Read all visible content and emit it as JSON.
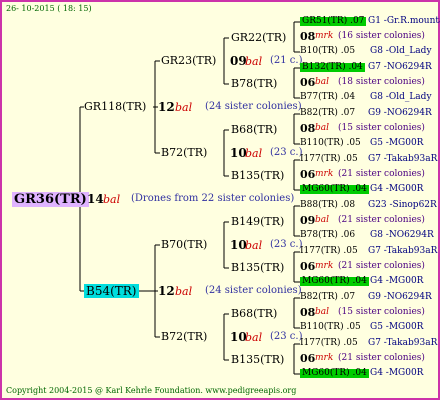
{
  "header": {
    "date": "26- 10-2015 ( 18: 15)"
  },
  "footer": {
    "copyright": "Copyright 2004-2015 @ Karl Kehrle Foundation.   www.pedigreeapis.org"
  },
  "root": {
    "id": "GR36(TR)",
    "year": "14",
    "mark": "bal",
    "note": "(Drones from 22 sister colonies)"
  },
  "gen1": {
    "top": {
      "id": "GR118(TR)",
      "year": "12",
      "mark": "bal",
      "note": "(24 sister colonies)"
    },
    "bottom": {
      "id": "B54(TR)",
      "year": "12",
      "mark": "bal",
      "note": "(24 sister colonies)"
    }
  },
  "gen2": [
    {
      "id": "GR23(TR)",
      "year": "09",
      "mark": "bal",
      "note": "(21 c.)"
    },
    {
      "id": "B72(TR)",
      "year": "10",
      "mark": "bal",
      "note": "(23 c.)"
    },
    {
      "id": "B70(TR)",
      "year": "10",
      "mark": "bal",
      "note": "(23 c.)"
    },
    {
      "id": "B72(TR)",
      "year": "10",
      "mark": "bal",
      "note": "(23 c.)"
    }
  ],
  "gen3": [
    "GR22(TR)",
    "B78(TR)",
    "B68(TR)",
    "B135(TR)",
    "B149(TR)",
    "B135(TR)",
    "B68(TR)",
    "B135(TR)"
  ],
  "gen4": [
    {
      "sire": "GR51(TR) .07",
      "sire_ped": "G1 -Gr.R.mounta",
      "year": "08",
      "mark": "mrk",
      "note": "(16 sister colonies)",
      "dam": "B10(TR) .05",
      "dam_ped": "G8 -Old_Lady"
    },
    {
      "sire": "B132(TR) .04",
      "sire_ped": "G7 -NO6294R",
      "year": "06",
      "mark": "bal",
      "note": "(18 sister colonies)",
      "dam": "B77(TR) .04",
      "dam_ped": "G8 -Old_Lady"
    },
    {
      "sire": "B82(TR) .07",
      "sire_ped": "G9 -NO6294R",
      "year": "08",
      "mark": "bal",
      "note": "(15 sister colonies)",
      "dam": "B110(TR) .05",
      "dam_ped": "G5 -MG00R"
    },
    {
      "sire": "I177(TR) .05",
      "sire_ped": "G7 -Takab93aR",
      "year": "06",
      "mark": "mrk",
      "note": "(21 sister colonies)",
      "dam": "MG60(TR) .04",
      "dam_ped": "G4 -MG00R"
    },
    {
      "sire": "B88(TR) .08",
      "sire_ped": "G23 -Sinop62R",
      "year": "09",
      "mark": "bal",
      "note": "(21 sister colonies)",
      "dam": "B78(TR) .06",
      "dam_ped": "G8 -NO6294R"
    },
    {
      "sire": "I177(TR) .05",
      "sire_ped": "G7 -Takab93aR",
      "year": "06",
      "mark": "mrk",
      "note": "(21 sister colonies)",
      "dam": "MG60(TR) .04",
      "dam_ped": "G4 -MG00R"
    },
    {
      "sire": "B82(TR) .07",
      "sire_ped": "G9 -NO6294R",
      "year": "08",
      "mark": "bal",
      "note": "(15 sister colonies)",
      "dam": "B110(TR) .05",
      "dam_ped": "G5 -MG00R"
    },
    {
      "sire": "I177(TR) .05",
      "sire_ped": "G7 -Takab93aR",
      "year": "06",
      "mark": "mrk",
      "note": "(21 sister colonies)",
      "dam": "MG60(TR) .04",
      "dam_ped": "G4 -MG00R"
    }
  ]
}
